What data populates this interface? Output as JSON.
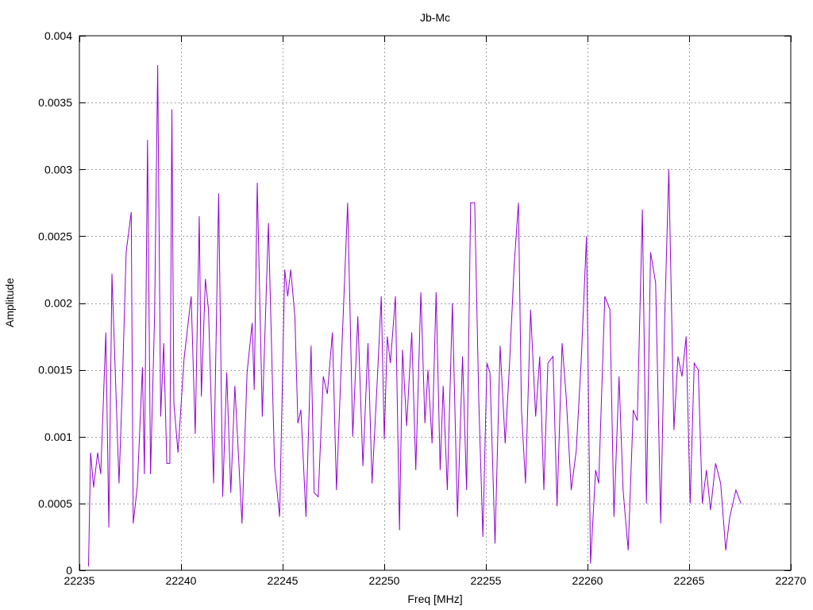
{
  "chart_data": {
    "type": "line",
    "title": "Jb-Mc",
    "xlabel": "Freq [MHz]",
    "ylabel": "Amplitude",
    "xlim": [
      22235,
      22270
    ],
    "ylim": [
      0,
      0.004
    ],
    "x_ticks": [
      22235,
      22240,
      22245,
      22250,
      22255,
      22260,
      22265,
      22270
    ],
    "y_ticks": [
      0,
      0.0005,
      0.001,
      0.0015,
      0.002,
      0.0025,
      0.003,
      0.0035,
      0.004
    ],
    "x_tick_labels": [
      "22235",
      "22240",
      "22245",
      "22250",
      "22255",
      "22260",
      "22265",
      "22270"
    ],
    "y_tick_labels": [
      "0",
      "0.0005",
      "0.001",
      "0.0015",
      "0.002",
      "0.0025",
      "0.003",
      "0.0035",
      "0.004"
    ],
    "grid": true,
    "series": [
      {
        "color": "#9400d3",
        "points": [
          [
            22235.45,
            3e-05
          ],
          [
            22235.55,
            0.00088
          ],
          [
            22235.7,
            0.00062
          ],
          [
            22235.9,
            0.00088
          ],
          [
            22236.05,
            0.00072
          ],
          [
            22236.3,
            0.00178
          ],
          [
            22236.45,
            0.00032
          ],
          [
            22236.6,
            0.00222
          ],
          [
            22236.95,
            0.00065
          ],
          [
            22237.1,
            0.00132
          ],
          [
            22237.3,
            0.00238
          ],
          [
            22237.55,
            0.00268
          ],
          [
            22237.65,
            0.00035
          ],
          [
            22237.85,
            0.00063
          ],
          [
            22238.1,
            0.00152
          ],
          [
            22238.2,
            0.00072
          ],
          [
            22238.35,
            0.00322
          ],
          [
            22238.5,
            0.00072
          ],
          [
            22238.7,
            0.0019
          ],
          [
            22238.85,
            0.00378
          ],
          [
            22239.0,
            0.00115
          ],
          [
            22239.15,
            0.0017
          ],
          [
            22239.3,
            0.0008
          ],
          [
            22239.45,
            0.0008
          ],
          [
            22239.55,
            0.00345
          ],
          [
            22239.65,
            0.00125
          ],
          [
            22239.85,
            0.00088
          ],
          [
            22240.15,
            0.00158
          ],
          [
            22240.5,
            0.00205
          ],
          [
            22240.7,
            0.00102
          ],
          [
            22240.9,
            0.00265
          ],
          [
            22241.0,
            0.0013
          ],
          [
            22241.2,
            0.00218
          ],
          [
            22241.35,
            0.00195
          ],
          [
            22241.6,
            0.00065
          ],
          [
            22241.85,
            0.00282
          ],
          [
            22242.05,
            0.00055
          ],
          [
            22242.25,
            0.00148
          ],
          [
            22242.45,
            0.00058
          ],
          [
            22242.65,
            0.00138
          ],
          [
            22243.0,
            0.00035
          ],
          [
            22243.25,
            0.00148
          ],
          [
            22243.5,
            0.00185
          ],
          [
            22243.6,
            0.00135
          ],
          [
            22243.75,
            0.0029
          ],
          [
            22244.0,
            0.00115
          ],
          [
            22244.3,
            0.0026
          ],
          [
            22244.6,
            0.00078
          ],
          [
            22244.85,
            0.0004
          ],
          [
            22245.1,
            0.00225
          ],
          [
            22245.25,
            0.00205
          ],
          [
            22245.4,
            0.00225
          ],
          [
            22245.6,
            0.0019
          ],
          [
            22245.75,
            0.0011
          ],
          [
            22245.9,
            0.0012
          ],
          [
            22246.15,
            0.0004
          ],
          [
            22246.4,
            0.00168
          ],
          [
            22246.55,
            0.00058
          ],
          [
            22246.75,
            0.00055
          ],
          [
            22247.0,
            0.00145
          ],
          [
            22247.2,
            0.00132
          ],
          [
            22247.45,
            0.00178
          ],
          [
            22247.65,
            0.0006
          ],
          [
            22247.9,
            0.0016
          ],
          [
            22248.2,
            0.00275
          ],
          [
            22248.45,
            0.001
          ],
          [
            22248.7,
            0.0019
          ],
          [
            22248.95,
            0.00078
          ],
          [
            22249.2,
            0.0017
          ],
          [
            22249.4,
            0.00065
          ],
          [
            22249.65,
            0.0014
          ],
          [
            22249.85,
            0.00205
          ],
          [
            22250.0,
            0.00098
          ],
          [
            22250.15,
            0.00175
          ],
          [
            22250.3,
            0.00155
          ],
          [
            22250.55,
            0.00205
          ],
          [
            22250.75,
            0.0003
          ],
          [
            22250.9,
            0.00165
          ],
          [
            22251.1,
            0.00108
          ],
          [
            22251.35,
            0.00178
          ],
          [
            22251.55,
            0.00075
          ],
          [
            22251.8,
            0.00208
          ],
          [
            22252.0,
            0.0011
          ],
          [
            22252.15,
            0.0015
          ],
          [
            22252.35,
            0.00095
          ],
          [
            22252.55,
            0.00208
          ],
          [
            22252.75,
            0.00075
          ],
          [
            22252.9,
            0.00138
          ],
          [
            22253.1,
            0.0006
          ],
          [
            22253.35,
            0.002
          ],
          [
            22253.6,
            0.0004
          ],
          [
            22253.85,
            0.0016
          ],
          [
            22254.05,
            0.0006
          ],
          [
            22254.25,
            0.00275
          ],
          [
            22254.45,
            0.00275
          ],
          [
            22254.65,
            0.00128
          ],
          [
            22254.85,
            0.00025
          ],
          [
            22255.05,
            0.00155
          ],
          [
            22255.2,
            0.00148
          ],
          [
            22255.45,
            0.0002
          ],
          [
            22255.7,
            0.00168
          ],
          [
            22255.95,
            0.00095
          ],
          [
            22256.15,
            0.0015
          ],
          [
            22256.4,
            0.0023
          ],
          [
            22256.6,
            0.00275
          ],
          [
            22256.75,
            0.0012
          ],
          [
            22256.95,
            0.00065
          ],
          [
            22257.2,
            0.00195
          ],
          [
            22257.45,
            0.00115
          ],
          [
            22257.65,
            0.0016
          ],
          [
            22257.85,
            0.0006
          ],
          [
            22258.05,
            0.00155
          ],
          [
            22258.3,
            0.0016
          ],
          [
            22258.5,
            0.00048
          ],
          [
            22258.75,
            0.0017
          ],
          [
            22258.95,
            0.0013
          ],
          [
            22259.2,
            0.0006
          ],
          [
            22259.45,
            0.0009
          ],
          [
            22259.7,
            0.0016
          ],
          [
            22259.95,
            0.0025
          ],
          [
            22260.15,
            5e-05
          ],
          [
            22260.4,
            0.00075
          ],
          [
            22260.55,
            0.00065
          ],
          [
            22260.85,
            0.00205
          ],
          [
            22261.1,
            0.00195
          ],
          [
            22261.3,
            0.0004
          ],
          [
            22261.55,
            0.00145
          ],
          [
            22261.75,
            0.0006
          ],
          [
            22262.0,
            0.00015
          ],
          [
            22262.25,
            0.0012
          ],
          [
            22262.45,
            0.00112
          ],
          [
            22262.7,
            0.0027
          ],
          [
            22262.9,
            0.0005
          ],
          [
            22263.1,
            0.00238
          ],
          [
            22263.35,
            0.00215
          ],
          [
            22263.6,
            0.00035
          ],
          [
            22263.8,
            0.0019
          ],
          [
            22264.0,
            0.003
          ],
          [
            22264.25,
            0.00105
          ],
          [
            22264.45,
            0.0016
          ],
          [
            22264.65,
            0.00145
          ],
          [
            22264.85,
            0.00175
          ],
          [
            22265.05,
            0.0005
          ],
          [
            22265.25,
            0.00155
          ],
          [
            22265.45,
            0.0015
          ],
          [
            22265.65,
            0.0005
          ],
          [
            22265.85,
            0.00075
          ],
          [
            22266.05,
            0.00045
          ],
          [
            22266.3,
            0.0008
          ],
          [
            22266.55,
            0.00065
          ],
          [
            22266.8,
            0.00015
          ],
          [
            22267.0,
            0.0004
          ],
          [
            22267.3,
            0.0006
          ],
          [
            22267.55,
            0.0005
          ]
        ]
      }
    ]
  }
}
